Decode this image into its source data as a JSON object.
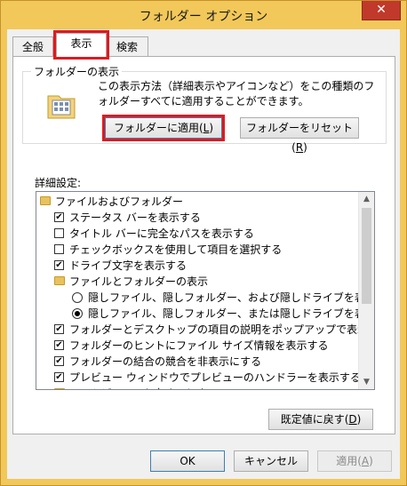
{
  "window": {
    "title": "フォルダー オプション",
    "close": "✕"
  },
  "tabs": [
    {
      "label": "全般"
    },
    {
      "label": "表示"
    },
    {
      "label": "検索"
    }
  ],
  "group": {
    "title": "フォルダーの表示",
    "description": "この表示方法（詳細表示やアイコンなど）をこの種類のフォルダーすべてに適用することができます。",
    "apply_button": {
      "label": "フォルダーに適用(",
      "key": "L",
      "end": ")"
    },
    "reset_button": {
      "label": "フォルダーをリセット(",
      "key": "R",
      "end": ")"
    }
  },
  "details": {
    "label": "詳細設定:",
    "items": [
      {
        "text": "ファイルおよびフォルダー",
        "kind": "folder"
      },
      {
        "text": "ステータス バーを表示する",
        "kind": "checkbox",
        "checked": true
      },
      {
        "text": "タイトル バーに完全なパスを表示する",
        "kind": "checkbox",
        "checked": false
      },
      {
        "text": "チェックボックスを使用して項目を選択する",
        "kind": "checkbox",
        "checked": false
      },
      {
        "text": "ドライブ文字を表示する",
        "kind": "checkbox",
        "checked": true
      },
      {
        "text": "ファイルとフォルダーの表示",
        "kind": "folder"
      },
      {
        "text": "隠しファイル、隠しフォルダー、および隠しドライブを表示する",
        "kind": "radio",
        "checked": false
      },
      {
        "text": "隠しファイル、隠しフォルダー、または隠しドライブを表示しない",
        "kind": "radio",
        "checked": true
      },
      {
        "text": "フォルダーとデスクトップの項目の説明をポップアップで表示する",
        "kind": "checkbox",
        "checked": true
      },
      {
        "text": "フォルダーのヒントにファイル サイズ情報を表示する",
        "kind": "checkbox",
        "checked": true
      },
      {
        "text": "フォルダーの結合の競合を非表示にする",
        "kind": "checkbox",
        "checked": true
      },
      {
        "text": "プレビュー ウィンドウでプレビューのハンドラーを表示する",
        "kind": "checkbox",
        "checked": true
      },
      {
        "text": "リストビューで入力するとき",
        "kind": "folder"
      }
    ]
  },
  "restore_button": {
    "label": "既定値に戻す(",
    "key": "D",
    "end": ")"
  },
  "footer": {
    "ok": "OK",
    "cancel": "キャンセル",
    "apply": {
      "label": "適用(",
      "key": "A",
      "end": ")"
    }
  },
  "colors": {
    "frame": "#f2c85a",
    "highlight": "#e0191f",
    "close": "#c0392b"
  }
}
